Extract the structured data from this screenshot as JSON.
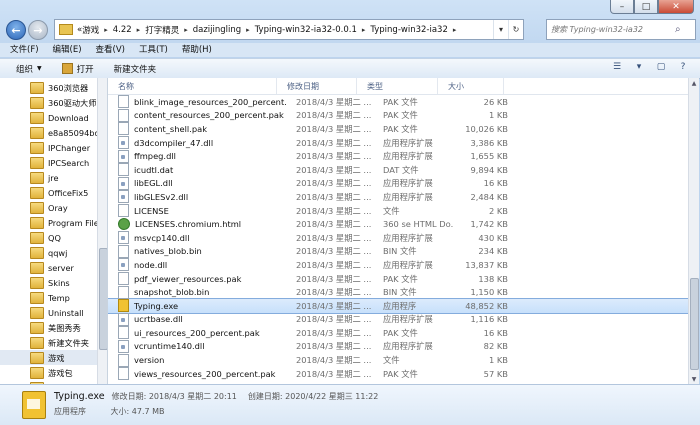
{
  "window": {
    "title_buttons": [
      "minimize",
      "maximize",
      "close"
    ]
  },
  "nav": {
    "breadcrumb": [
      "«",
      "游戏",
      "4.22",
      "打字精灵",
      "dazijingling",
      "Typing-win32-ia32-0.0.1",
      "Typing-win32-ia32"
    ],
    "search_placeholder": "搜索 Typing-win32-ia32"
  },
  "menu": [
    "文件(F)",
    "编辑(E)",
    "查看(V)",
    "工具(T)",
    "帮助(H)"
  ],
  "toolbar": {
    "organize": "组织",
    "open": "打开",
    "new_folder": "新建文件夹"
  },
  "sidebar": {
    "items": [
      "360浏览器",
      "360驱动大师目",
      "Download",
      "e8a85094bdb",
      "IPChanger",
      "IPCSearch",
      "jre",
      "OfficeFix5",
      "Oray",
      "Program Files",
      "QQ",
      "qqwj",
      "server",
      "Skins",
      "Temp",
      "Uninstall",
      "美图秀秀",
      "新建文件夹",
      "游戏",
      "游戏包",
      "游戏软广"
    ],
    "selected": "游戏"
  },
  "columns": {
    "name": "名称",
    "date": "修改日期",
    "type": "类型",
    "size": "大小"
  },
  "files": [
    {
      "name": "blink_image_resources_200_percent.p...",
      "date": "2018/4/3 星期二 ...",
      "type": "PAK 文件",
      "size": "26 KB",
      "icon": "doc"
    },
    {
      "name": "content_resources_200_percent.pak",
      "date": "2018/4/3 星期二 ...",
      "type": "PAK 文件",
      "size": "1 KB",
      "icon": "doc"
    },
    {
      "name": "content_shell.pak",
      "date": "2018/4/3 星期二 ...",
      "type": "PAK 文件",
      "size": "10,026 KB",
      "icon": "doc"
    },
    {
      "name": "d3dcompiler_47.dll",
      "date": "2018/4/3 星期二 ...",
      "type": "应用程序扩展",
      "size": "3,386 KB",
      "icon": "dll"
    },
    {
      "name": "ffmpeg.dll",
      "date": "2018/4/3 星期二 ...",
      "type": "应用程序扩展",
      "size": "1,655 KB",
      "icon": "dll"
    },
    {
      "name": "icudtl.dat",
      "date": "2018/4/3 星期二 ...",
      "type": "DAT 文件",
      "size": "9,894 KB",
      "icon": "doc"
    },
    {
      "name": "libEGL.dll",
      "date": "2018/4/3 星期二 ...",
      "type": "应用程序扩展",
      "size": "16 KB",
      "icon": "dll"
    },
    {
      "name": "libGLESv2.dll",
      "date": "2018/4/3 星期二 ...",
      "type": "应用程序扩展",
      "size": "2,484 KB",
      "icon": "dll"
    },
    {
      "name": "LICENSE",
      "date": "2018/4/3 星期二 ...",
      "type": "文件",
      "size": "2 KB",
      "icon": "doc"
    },
    {
      "name": "LICENSES.chromium.html",
      "date": "2018/4/3 星期二 ...",
      "type": "360 se HTML Do...",
      "size": "1,742 KB",
      "icon": "html"
    },
    {
      "name": "msvcp140.dll",
      "date": "2018/4/3 星期二 ...",
      "type": "应用程序扩展",
      "size": "430 KB",
      "icon": "dll"
    },
    {
      "name": "natives_blob.bin",
      "date": "2018/4/3 星期二 ...",
      "type": "BIN 文件",
      "size": "234 KB",
      "icon": "doc"
    },
    {
      "name": "node.dll",
      "date": "2018/4/3 星期二 ...",
      "type": "应用程序扩展",
      "size": "13,837 KB",
      "icon": "dll"
    },
    {
      "name": "pdf_viewer_resources.pak",
      "date": "2018/4/3 星期二 ...",
      "type": "PAK 文件",
      "size": "138 KB",
      "icon": "doc"
    },
    {
      "name": "snapshot_blob.bin",
      "date": "2018/4/3 星期二 ...",
      "type": "BIN 文件",
      "size": "1,150 KB",
      "icon": "doc"
    },
    {
      "name": "Typing.exe",
      "date": "2018/4/3 星期二 ...",
      "type": "应用程序",
      "size": "48,852 KB",
      "icon": "exe",
      "selected": true
    },
    {
      "name": "ucrtbase.dll",
      "date": "2018/4/3 星期二 ...",
      "type": "应用程序扩展",
      "size": "1,116 KB",
      "icon": "dll"
    },
    {
      "name": "ui_resources_200_percent.pak",
      "date": "2018/4/3 星期二 ...",
      "type": "PAK 文件",
      "size": "16 KB",
      "icon": "doc"
    },
    {
      "name": "vcruntime140.dll",
      "date": "2018/4/3 星期二 ...",
      "type": "应用程序扩展",
      "size": "82 KB",
      "icon": "dll"
    },
    {
      "name": "version",
      "date": "2018/4/3 星期二 ...",
      "type": "文件",
      "size": "1 KB",
      "icon": "doc"
    },
    {
      "name": "views_resources_200_percent.pak",
      "date": "2018/4/3 星期二 ...",
      "type": "PAK 文件",
      "size": "57 KB",
      "icon": "doc"
    }
  ],
  "status": {
    "filename": "Typing.exe",
    "modified": "修改日期: 2018/4/3 星期二 20:11",
    "created": "创建日期: 2020/4/22 星期三 11:22",
    "type": "应用程序",
    "size": "大小: 47.7 MB"
  }
}
